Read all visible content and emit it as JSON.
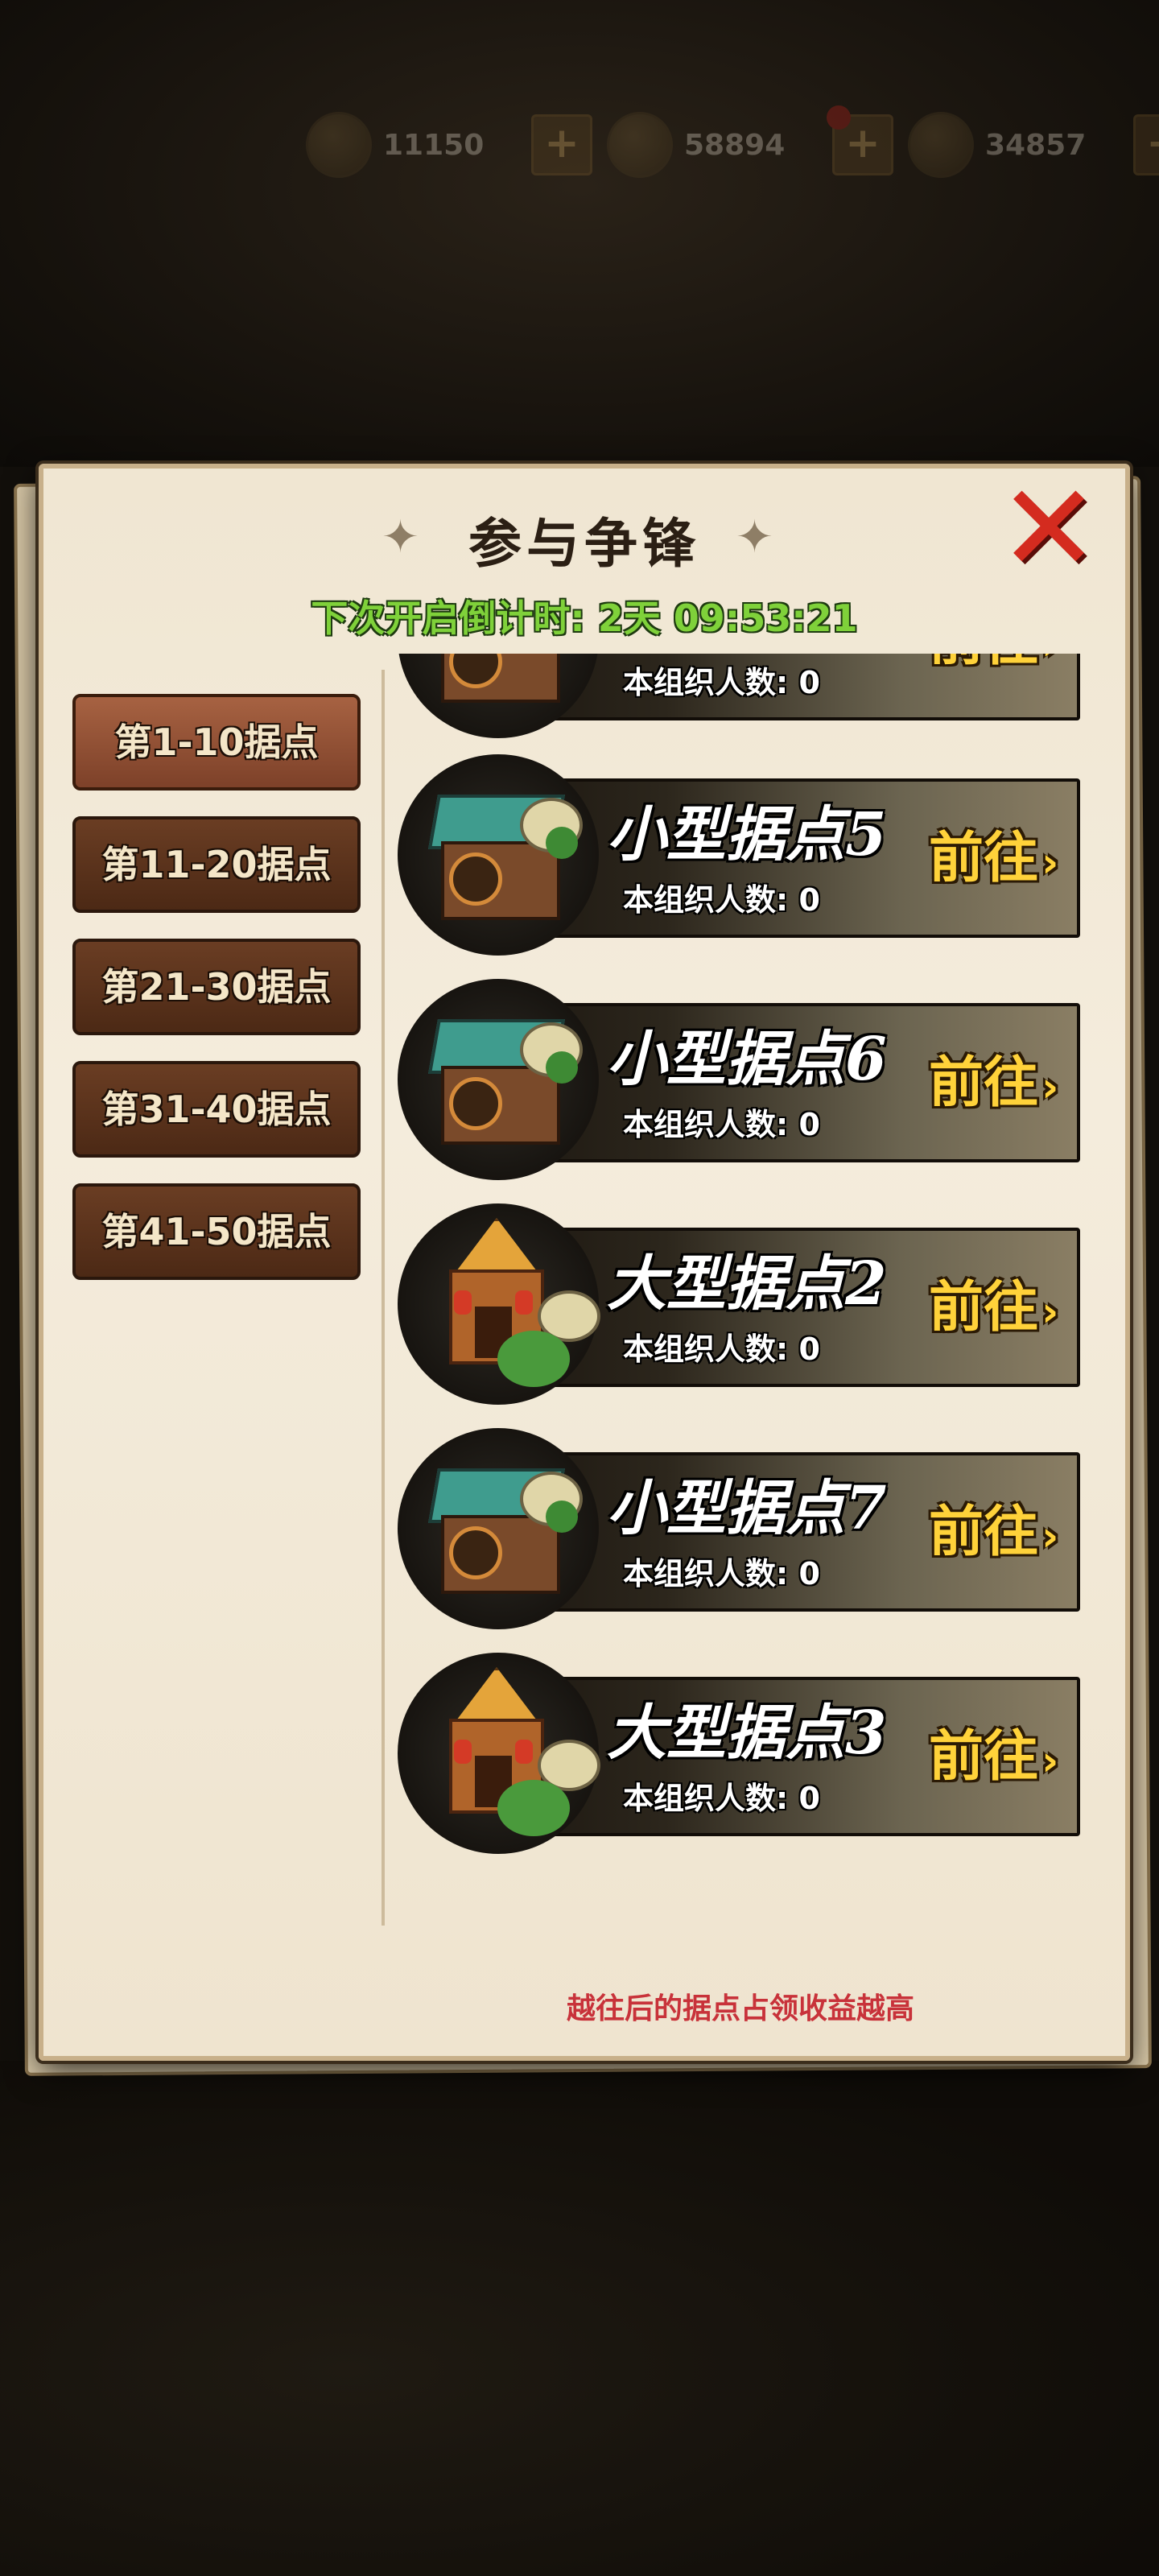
{
  "resources": [
    {
      "icon": "energy-coin-icon",
      "amount": "11150"
    },
    {
      "icon": "gold-coin-icon",
      "amount": "58894"
    },
    {
      "icon": "gem-icon",
      "amount": "34857"
    }
  ],
  "dialog": {
    "title": "参与争锋",
    "countdown": "下次开启倒计时: 2天  09:53:21",
    "hint": "越往后的据点占领收益越高"
  },
  "tabs": [
    {
      "label": "第1-10据点",
      "active": true
    },
    {
      "label": "第11-20据点",
      "active": false
    },
    {
      "label": "第21-30据点",
      "active": false
    },
    {
      "label": "第31-40据点",
      "active": false
    },
    {
      "label": "第41-50据点",
      "active": false
    }
  ],
  "strongholds": [
    {
      "name": "",
      "members_label": "本组织人数:",
      "members": "0",
      "go_label": "前往",
      "type": "small"
    },
    {
      "name": "小型据点5",
      "members_label": "本组织人数:",
      "members": "0",
      "go_label": "前往",
      "type": "small"
    },
    {
      "name": "小型据点6",
      "members_label": "本组织人数:",
      "members": "0",
      "go_label": "前往",
      "type": "small"
    },
    {
      "name": "大型据点2",
      "members_label": "本组织人数:",
      "members": "0",
      "go_label": "前往",
      "type": "large"
    },
    {
      "name": "小型据点7",
      "members_label": "本组织人数:",
      "members": "0",
      "go_label": "前往",
      "type": "small"
    },
    {
      "name": "大型据点3",
      "members_label": "本组织人数:",
      "members": "0",
      "go_label": "前往",
      "type": "large"
    }
  ]
}
